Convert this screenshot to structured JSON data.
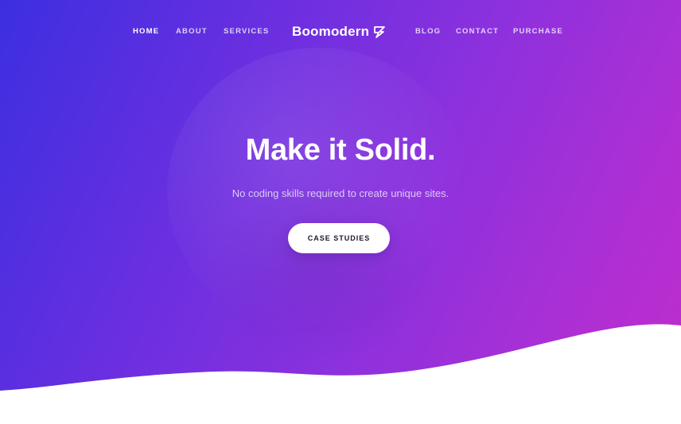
{
  "nav": {
    "left_items": [
      {
        "label": "HOME",
        "active": true
      },
      {
        "label": "ABOUT",
        "active": false
      },
      {
        "label": "SERVICES",
        "active": false
      }
    ],
    "brand": "Boomodern",
    "brand_icon": "lightning-icon",
    "right_items": [
      {
        "label": "BLOG",
        "active": false
      },
      {
        "label": "CONTACT",
        "active": false
      },
      {
        "label": "PURCHASE",
        "active": false
      }
    ]
  },
  "hero": {
    "title": "Make it Solid.",
    "subtitle": "No coding skills required to create unique sites.",
    "cta_label": "CASE STUDIES"
  },
  "colors": {
    "gradient_start": "#3c2fe0",
    "gradient_end": "#c02ccb",
    "button_bg": "#ffffff",
    "page_bg": "#ffffff"
  }
}
